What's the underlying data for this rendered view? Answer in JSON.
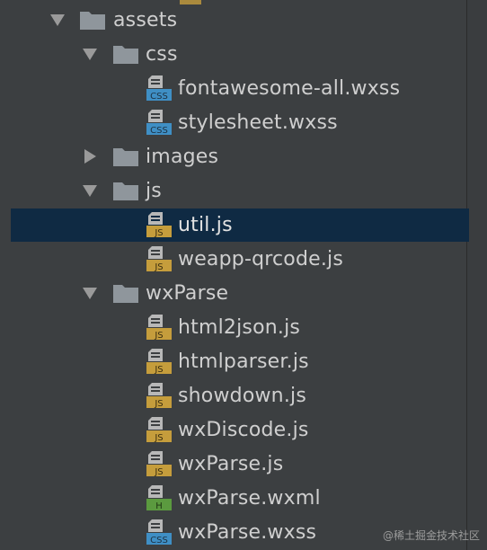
{
  "tree": {
    "rows": [
      {
        "label": "assets",
        "kind": "folder",
        "state": "expanded"
      },
      {
        "label": "css",
        "kind": "folder",
        "state": "expanded"
      },
      {
        "label": "fontawesome-all.wxss",
        "kind": "file",
        "badge": "CSS"
      },
      {
        "label": "stylesheet.wxss",
        "kind": "file",
        "badge": "CSS"
      },
      {
        "label": "images",
        "kind": "folder",
        "state": "collapsed"
      },
      {
        "label": "js",
        "kind": "folder",
        "state": "expanded"
      },
      {
        "label": "util.js",
        "kind": "file",
        "badge": "JS",
        "selected": true
      },
      {
        "label": "weapp-qrcode.js",
        "kind": "file",
        "badge": "JS"
      },
      {
        "label": "wxParse",
        "kind": "folder",
        "state": "expanded"
      },
      {
        "label": "html2json.js",
        "kind": "file",
        "badge": "JS"
      },
      {
        "label": "htmlparser.js",
        "kind": "file",
        "badge": "JS"
      },
      {
        "label": "showdown.js",
        "kind": "file",
        "badge": "JS"
      },
      {
        "label": "wxDiscode.js",
        "kind": "file",
        "badge": "JS"
      },
      {
        "label": "wxParse.js",
        "kind": "file",
        "badge": "JS"
      },
      {
        "label": "wxParse.wxml",
        "kind": "file",
        "badge": "H"
      },
      {
        "label": "wxParse.wxss",
        "kind": "file",
        "badge": "CSS"
      }
    ]
  },
  "icons": {
    "folder": "folder-icon",
    "css": "css-file-icon",
    "js": "js-file-icon",
    "html": "html-file-icon",
    "expanded": "chevron-down-icon",
    "collapsed": "chevron-right-icon"
  },
  "colors": {
    "background": "#3c3f41",
    "selected": "#0f2a43",
    "text": "#cfcfcf",
    "folder": "#8f969c",
    "css_badge": "#3f8fc5",
    "js_badge": "#c59d3c",
    "html_badge": "#5b9a3f"
  },
  "watermark": "@稀土掘金技术社区"
}
